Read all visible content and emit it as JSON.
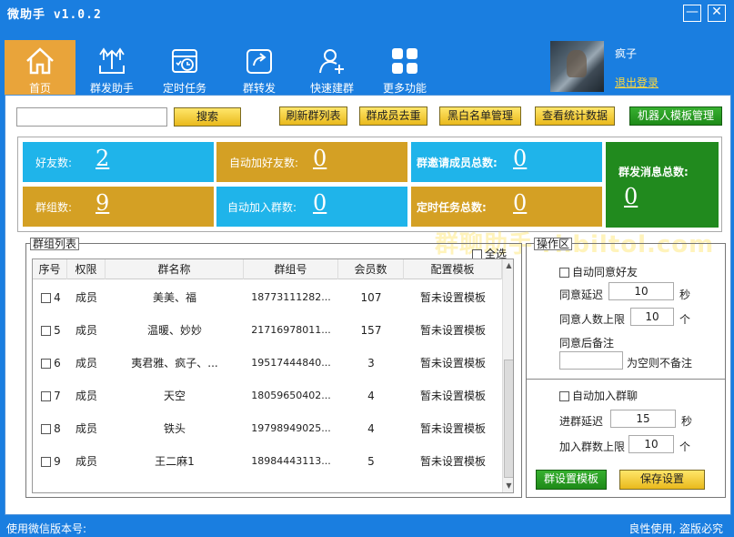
{
  "app": {
    "title": "微助手 v1.0.2",
    "minimize": "—",
    "close": "✕"
  },
  "toolbar": [
    {
      "label": "首页",
      "icon": "home-icon"
    },
    {
      "label": "群发助手",
      "icon": "upload-icon"
    },
    {
      "label": "定时任务",
      "icon": "schedule-icon"
    },
    {
      "label": "群转发",
      "icon": "share-icon"
    },
    {
      "label": "快速建群",
      "icon": "add-user-icon"
    },
    {
      "label": "更多功能",
      "icon": "grid-icon"
    }
  ],
  "user": {
    "name": "疯子",
    "logout": "退出登录"
  },
  "actions": {
    "search": "搜索",
    "refresh": "刷新群列表",
    "dedupe": "群成员去重",
    "blacklist": "黑白名单管理",
    "stats": "查看统计数据",
    "robot": "机器人模板管理"
  },
  "stats": {
    "friends": {
      "label": "好友数:",
      "value": "2"
    },
    "auto_add_friends": {
      "label": "自动加好友数:",
      "value": "0"
    },
    "invite_total": {
      "label": "群邀请成员总数:",
      "value": "0"
    },
    "broadcast_total": {
      "label": "群发消息总数:",
      "value": "0"
    },
    "groups": {
      "label": "群组数:",
      "value": "9"
    },
    "auto_join": {
      "label": "自动加入群数:",
      "value": "0"
    },
    "scheduled_total": {
      "label": "定时任务总数:",
      "value": "0"
    }
  },
  "group_list": {
    "title": "群组列表",
    "select_all": "全选",
    "columns": [
      "序号",
      "权限",
      "群名称",
      "群组号",
      "会员数",
      "配置模板"
    ],
    "rows": [
      {
        "index": "4",
        "role": "成员",
        "name": "美美、福",
        "id": "18773111282...",
        "members": "107",
        "template": "暂未设置模板"
      },
      {
        "index": "5",
        "role": "成员",
        "name": "温暖、妙妙",
        "id": "21716978011...",
        "members": "157",
        "template": "暂未设置模板"
      },
      {
        "index": "6",
        "role": "成员",
        "name": "夷君雅、疯子、...",
        "id": "19517444840...",
        "members": "3",
        "template": "暂未设置模板"
      },
      {
        "index": "7",
        "role": "成员",
        "name": "天空",
        "id": "18059650402...",
        "members": "4",
        "template": "暂未设置模板"
      },
      {
        "index": "8",
        "role": "成员",
        "name": "铁头",
        "id": "19798949025...",
        "members": "4",
        "template": "暂未设置模板"
      },
      {
        "index": "9",
        "role": "成员",
        "name": "王二麻1",
        "id": "18984443113...",
        "members": "5",
        "template": "暂未设置模板"
      }
    ]
  },
  "operations": {
    "title": "操作区",
    "auto_accept": "自动同意好友",
    "accept_delay_label": "同意延迟",
    "accept_delay_value": "10",
    "accept_delay_unit": "秒",
    "accept_limit_label": "同意人数上限",
    "accept_limit_value": "10",
    "accept_limit_unit": "个",
    "remark_label": "同意后备注",
    "remark_value": "",
    "remark_hint": "为空则不备注",
    "auto_join": "自动加入群聊",
    "join_delay_label": "进群延迟",
    "join_delay_value": "15",
    "join_delay_unit": "秒",
    "join_limit_label": "加入群数上限",
    "join_limit_value": "10",
    "join_limit_unit": "个",
    "group_template_btn": "群设置模板",
    "save_btn": "保存设置"
  },
  "watermark": "群聊助手 rhbiltol.com",
  "status": {
    "left": "使用微信版本号:",
    "right": "良性使用, 盗版必究"
  }
}
